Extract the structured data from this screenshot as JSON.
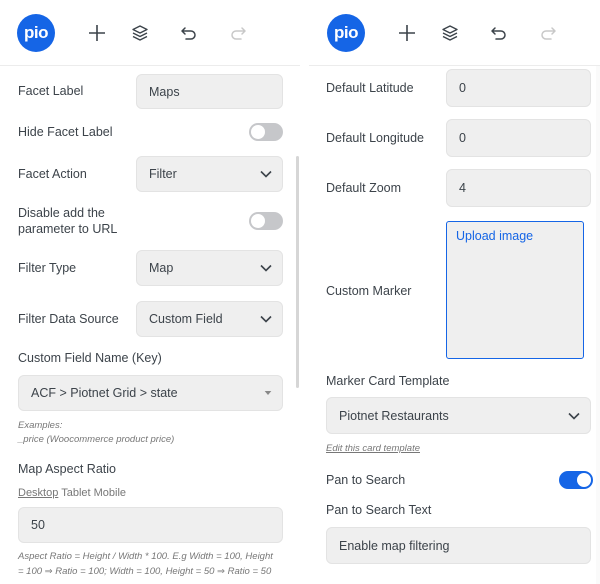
{
  "colors": {
    "accent": "#1565e6",
    "field_bg": "#efefef",
    "toggle_off": "#c6c7ca"
  },
  "toolbar": {
    "logo_text": "pio",
    "icons": [
      "plus-icon",
      "layers-icon",
      "undo-icon",
      "redo-icon"
    ]
  },
  "left": {
    "facet_label": {
      "label": "Facet Label",
      "value": "Maps"
    },
    "hide_facet_label": {
      "label": "Hide Facet Label",
      "on": false
    },
    "facet_action": {
      "label": "Facet Action",
      "value": "Filter"
    },
    "disable_param": {
      "label_line1": "Disable add the",
      "label_line2": "parameter to URL",
      "on": false
    },
    "filter_type": {
      "label": "Filter Type",
      "value": "Map"
    },
    "filter_data_source": {
      "label": "Filter Data Source",
      "value": "Custom Field"
    },
    "custom_field_name": {
      "label": "Custom Field Name (Key)",
      "value": "ACF > Piotnet Grid > state"
    },
    "examples": {
      "line1": "Examples:",
      "line2": "_price (Woocommerce product price)"
    },
    "map_aspect_ratio": {
      "label": "Map Aspect Ratio",
      "devices": [
        "Desktop",
        "Tablet",
        "Mobile"
      ],
      "value": "50",
      "note_line1": "Aspect Ratio = Height / Width * 100. E.g Width = 100, Height",
      "note_line2": "= 100 ⇒ Ratio = 100; Width = 100, Height = 50 ⇒ Ratio = 50"
    }
  },
  "right": {
    "default_latitude": {
      "label": "Default Latitude",
      "value": "0"
    },
    "default_longitude": {
      "label": "Default Longitude",
      "value": "0"
    },
    "default_zoom": {
      "label": "Default Zoom",
      "value": "4"
    },
    "custom_marker": {
      "label": "Custom Marker",
      "upload_text": "Upload image"
    },
    "marker_card_template": {
      "label": "Marker Card Template",
      "value": "Piotnet Restaurants",
      "edit_link": "Edit this card template"
    },
    "pan_to_search": {
      "label": "Pan to Search",
      "on": true
    },
    "pan_to_search_text": {
      "label": "Pan to Search Text",
      "value": "Enable map filtering"
    }
  }
}
